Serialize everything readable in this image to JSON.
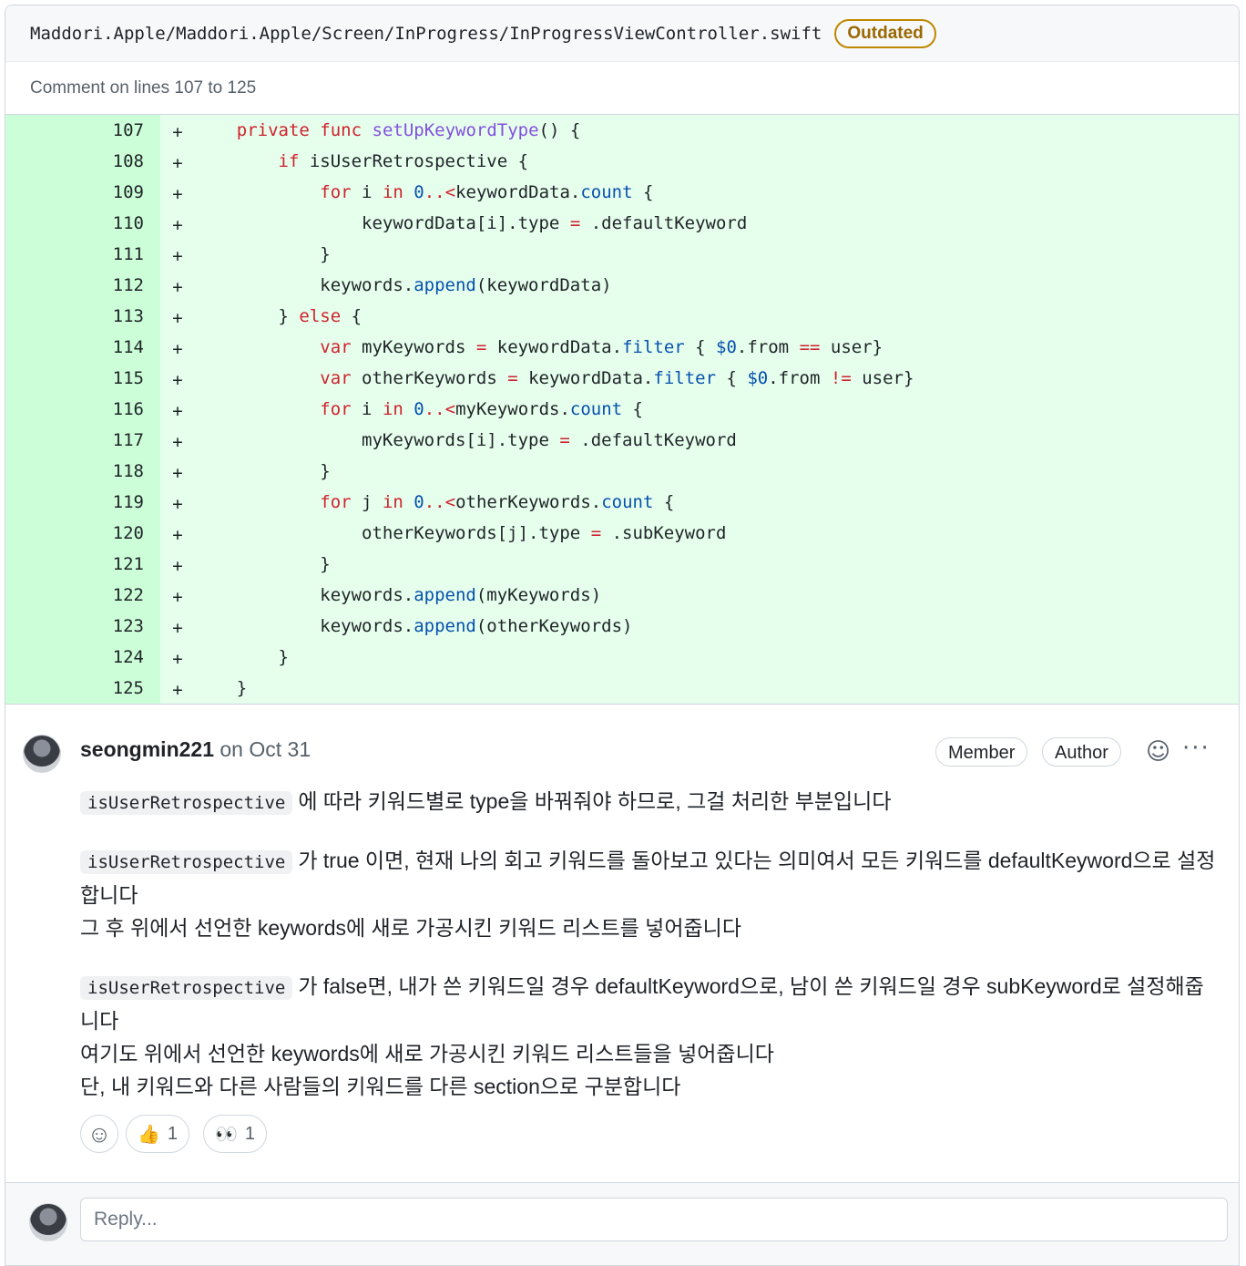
{
  "file": {
    "path": "Maddori.Apple/Maddori.Apple/Screen/InProgress/InProgressViewController.swift",
    "badge": "Outdated",
    "comment_range": "Comment on lines 107 to 125"
  },
  "code": {
    "marker": "+",
    "lines": [
      {
        "num": "107",
        "html": "    <span class=\"kw\">private</span> <span class=\"kw\">func</span> <span class=\"fn\">setUpKeywordType</span>() {"
      },
      {
        "num": "108",
        "html": "        <span class=\"kw\">if</span> isUserRetrospective {"
      },
      {
        "num": "109",
        "html": "            <span class=\"kw\">for</span> i <span class=\"kw\">in</span> <span class=\"bl\">0</span><span class=\"kw\">..&lt;</span>keywordData.<span class=\"bl\">count</span> {"
      },
      {
        "num": "110",
        "html": "                keywordData[i].type <span class=\"kw\">=</span> .defaultKeyword"
      },
      {
        "num": "111",
        "html": "            }"
      },
      {
        "num": "112",
        "html": "            keywords.<span class=\"bl\">append</span>(keywordData)"
      },
      {
        "num": "113",
        "html": "        } <span class=\"kw\">else</span> {"
      },
      {
        "num": "114",
        "html": "            <span class=\"kw\">var</span> myKeywords <span class=\"kw\">=</span> keywordData.<span class=\"bl\">filter</span> { <span class=\"bl\">$0</span>.from <span class=\"kw\">==</span> user}"
      },
      {
        "num": "115",
        "html": "            <span class=\"kw\">var</span> otherKeywords <span class=\"kw\">=</span> keywordData.<span class=\"bl\">filter</span> { <span class=\"bl\">$0</span>.from <span class=\"kw\">!=</span> user}"
      },
      {
        "num": "116",
        "html": "            <span class=\"kw\">for</span> i <span class=\"kw\">in</span> <span class=\"bl\">0</span><span class=\"kw\">..&lt;</span>myKeywords.<span class=\"bl\">count</span> {"
      },
      {
        "num": "117",
        "html": "                myKeywords[i].type <span class=\"kw\">=</span> .defaultKeyword"
      },
      {
        "num": "118",
        "html": "            }"
      },
      {
        "num": "119",
        "html": "            <span class=\"kw\">for</span> j <span class=\"kw\">in</span> <span class=\"bl\">0</span><span class=\"kw\">..&lt;</span>otherKeywords.<span class=\"bl\">count</span> {"
      },
      {
        "num": "120",
        "html": "                otherKeywords[j].type <span class=\"kw\">=</span> .subKeyword"
      },
      {
        "num": "121",
        "html": "            }"
      },
      {
        "num": "122",
        "html": "            keywords.<span class=\"bl\">append</span>(myKeywords)"
      },
      {
        "num": "123",
        "html": "            keywords.<span class=\"bl\">append</span>(otherKeywords)"
      },
      {
        "num": "124",
        "html": "        }"
      },
      {
        "num": "125",
        "html": "    }"
      }
    ]
  },
  "comment": {
    "author": "seongmin221",
    "date": "on Oct 31",
    "badges": {
      "member": "Member",
      "author": "Author"
    },
    "emoji_icon": "smiley-icon",
    "more_icon": "kebab-menu-icon",
    "code_term": "isUserRetrospective",
    "p1": "에 따라 키워드별로 type을 바꿔줘야 하므로, 그걸 처리한 부분입니다",
    "p2_line1": "가 true 이면, 현재 나의 회고 키워드를 돌아보고 있다는 의미여서 모든 키워드를 defaultKeyword으로 설정합니다",
    "p2_line2": "그 후 위에서 선언한 keywords에 새로 가공시킨 키워드 리스트를 넣어줍니다",
    "p3_line1": "가 false면, 내가 쓴 키워드일 경우 defaultKeyword으로, 남이 쓴 키워드일 경우 subKeyword로 설정해줍니다",
    "p3_line2": "여기도 위에서 선언한 keywords에 새로 가공시킨 키워드 리스트들을 넣어줍니다",
    "p3_line3": "단, 내 키워드와 다른 사람들의 키워드를 다른 section으로 구분합니다",
    "reactions": {
      "add_icon": "smiley-add-icon",
      "thumbs": {
        "emoji": "👍",
        "count": "1"
      },
      "eyes": {
        "emoji": "👀",
        "count": "1"
      }
    }
  },
  "reply": {
    "placeholder": "Reply..."
  }
}
